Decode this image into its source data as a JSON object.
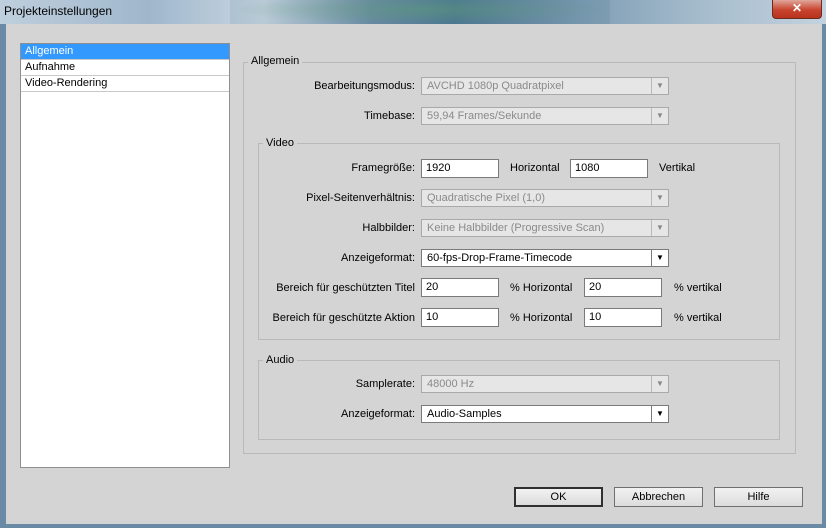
{
  "window": {
    "title": "Projekteinstellungen",
    "close_glyph": "✕"
  },
  "sidebar": {
    "items": [
      {
        "label": "Allgemein"
      },
      {
        "label": "Aufnahme"
      },
      {
        "label": "Video-Rendering"
      }
    ]
  },
  "general": {
    "title": "Allgemein",
    "editing_mode_label": "Bearbeitungsmodus:",
    "editing_mode_value": "AVCHD 1080p Quadratpixel",
    "timebase_label": "Timebase:",
    "timebase_value": "59,94 Frames/Sekunde"
  },
  "video": {
    "title": "Video",
    "frame_size_label": "Framegröße:",
    "frame_width": "1920",
    "horizontal_label": "Horizontal",
    "frame_height": "1080",
    "vertical_label": "Vertikal",
    "pixel_aspect_label": "Pixel-Seitenverhältnis:",
    "pixel_aspect_value": "Quadratische Pixel (1,0)",
    "fields_label": "Halbbilder:",
    "fields_value": "Keine Halbbilder (Progressive Scan)",
    "display_format_label": "Anzeigeformat:",
    "display_format_value": "60-fps-Drop-Frame-Timecode",
    "title_safe_label": "Bereich für geschützten Titel",
    "title_safe_h": "20",
    "title_safe_v": "20",
    "action_safe_label": "Bereich für geschützte Aktion",
    "action_safe_h": "10",
    "action_safe_v": "10",
    "pct_horizontal": "% Horizontal",
    "pct_vertical": "% vertikal"
  },
  "audio": {
    "title": "Audio",
    "sample_rate_label": "Samplerate:",
    "sample_rate_value": "48000 Hz",
    "display_format_label": "Anzeigeformat:",
    "display_format_value": "Audio-Samples"
  },
  "buttons": {
    "ok": "OK",
    "cancel": "Abbrechen",
    "help": "Hilfe"
  },
  "arrow_glyph": "▼"
}
